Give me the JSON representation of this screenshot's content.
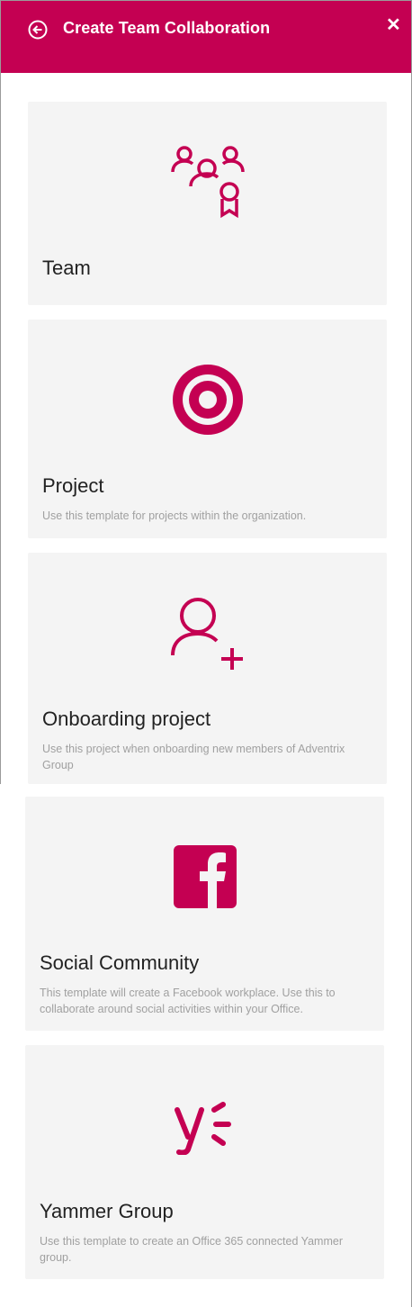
{
  "header": {
    "title": "Create Team Collaboration",
    "back_icon": "arrow-left-circle-icon",
    "close_label": "✕"
  },
  "accent": "#c40052",
  "templates": [
    {
      "name": "Team",
      "description": "",
      "icon": "team-award-icon"
    },
    {
      "name": "Project",
      "description": "Use this template for projects within the organization.",
      "icon": "target-icon"
    },
    {
      "name": "Onboarding project",
      "description": "Use this project when onboarding new members of Adventrix Group",
      "icon": "add-person-icon"
    },
    {
      "name": "Social Community",
      "description": "This template will create a Facebook workplace. Use this to collaborate around social activities within your Office.",
      "icon": "facebook-icon"
    },
    {
      "name": "Yammer Group",
      "description": "Use this template to create an Office 365 connected Yammer group.",
      "icon": "yammer-icon"
    }
  ]
}
